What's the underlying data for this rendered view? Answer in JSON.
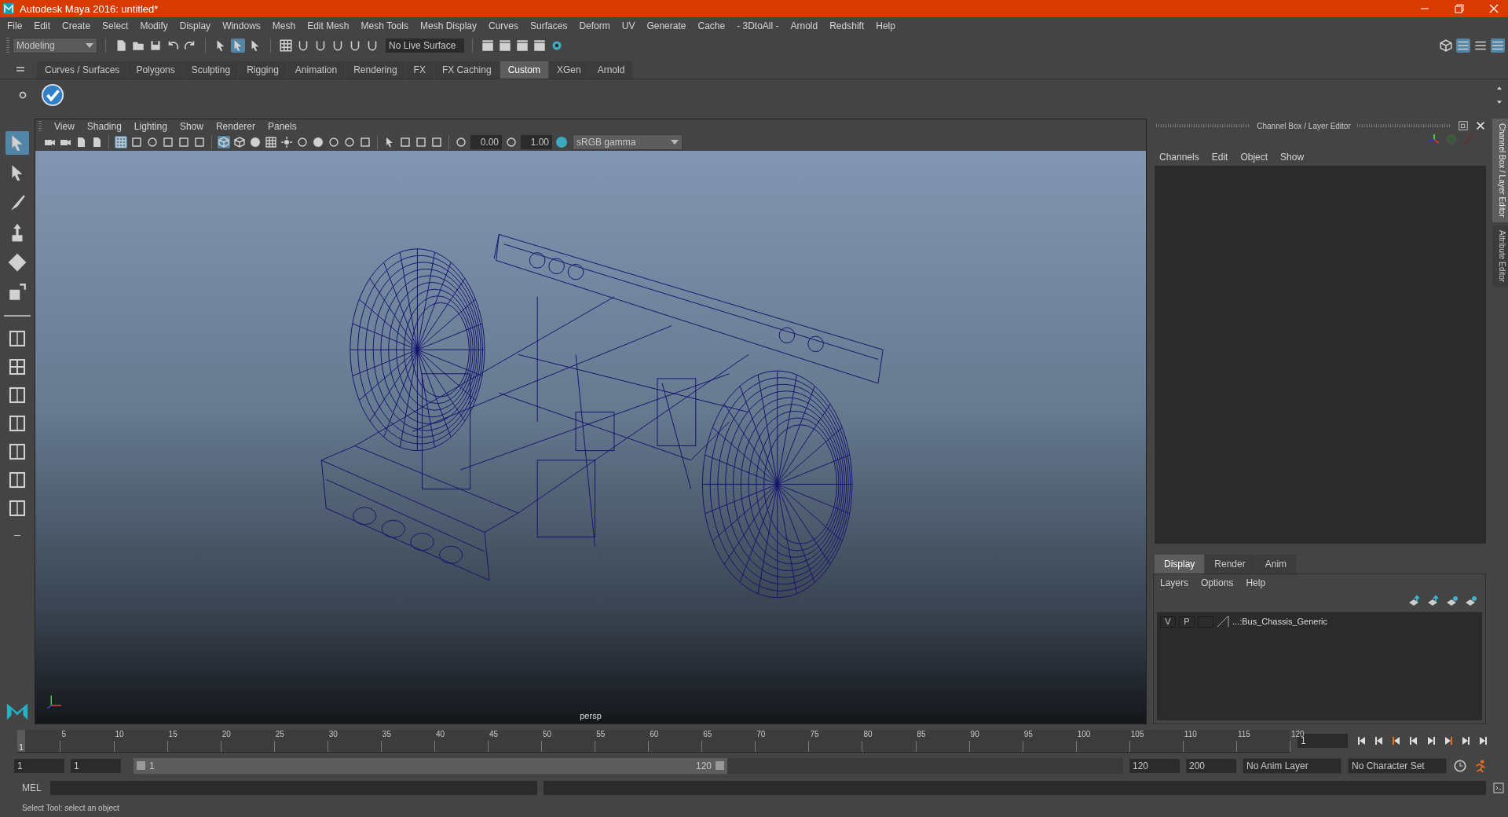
{
  "window": {
    "title": "Autodesk Maya 2016: untitled*"
  },
  "menu_bar": [
    "File",
    "Edit",
    "Create",
    "Select",
    "Modify",
    "Display",
    "Windows",
    "Mesh",
    "Edit Mesh",
    "Mesh Tools",
    "Mesh Display",
    "Curves",
    "Surfaces",
    "Deform",
    "UV",
    "Generate",
    "Cache",
    "- 3DtoAll -",
    "Arnold",
    "Redshift",
    "Help"
  ],
  "status_line": {
    "mode": "Modeling",
    "live_surface": "No Live Surface"
  },
  "shelf_tabs": [
    {
      "label": "Curves / Surfaces",
      "selected": false
    },
    {
      "label": "Polygons",
      "selected": false
    },
    {
      "label": "Sculpting",
      "selected": false
    },
    {
      "label": "Rigging",
      "selected": false
    },
    {
      "label": "Animation",
      "selected": false
    },
    {
      "label": "Rendering",
      "selected": false
    },
    {
      "label": "FX",
      "selected": false
    },
    {
      "label": "FX Caching",
      "selected": false
    },
    {
      "label": "Custom",
      "selected": true
    },
    {
      "label": "XGen",
      "selected": false
    },
    {
      "label": "Arnold",
      "selected": false
    }
  ],
  "tools": [
    {
      "selected": true
    },
    {
      "selected": false
    },
    {
      "selected": false
    },
    {
      "selected": false
    },
    {
      "selected": false
    },
    {
      "selected": false
    }
  ],
  "viewport": {
    "menus": [
      "View",
      "Shading",
      "Lighting",
      "Show",
      "Renderer",
      "Panels"
    ],
    "exposure": "0.00",
    "gamma": "1.00",
    "color_space": "sRGB gamma",
    "camera": "persp"
  },
  "channel_box": {
    "title": "Channel Box / Layer Editor",
    "menus": [
      "Channels",
      "Edit",
      "Object",
      "Show"
    ]
  },
  "layer_editor": {
    "tabs": [
      {
        "label": "Display",
        "selected": true
      },
      {
        "label": "Render",
        "selected": false
      },
      {
        "label": "Anim",
        "selected": false
      }
    ],
    "menus": [
      "Layers",
      "Options",
      "Help"
    ],
    "layers": [
      {
        "visible": "V",
        "playback": "P",
        "name": "...:Bus_Chassis_Generic"
      }
    ]
  },
  "side_tabs": [
    "Channel Box / Layer Editor",
    "Attribute Editor"
  ],
  "timeline": {
    "ticks": [
      "5",
      "10",
      "15",
      "20",
      "25",
      "30",
      "35",
      "40",
      "45",
      "50",
      "55",
      "60",
      "65",
      "70",
      "75",
      "80",
      "85",
      "90",
      "95",
      "100",
      "105",
      "110",
      "115",
      "120"
    ],
    "current_frame_label": "1",
    "current_frame": "1",
    "level": 0
  },
  "range_slider": {
    "start_time": "1",
    "playback_start": "1",
    "range_start": "1",
    "range_end": "120",
    "playback_end": "120",
    "end_time": "200",
    "level": 0.6,
    "anim_layer": "No Anim Layer",
    "character_set": "No Character Set"
  },
  "command_line": {
    "label": "MEL"
  },
  "status_bar": "Select Tool: select an object"
}
